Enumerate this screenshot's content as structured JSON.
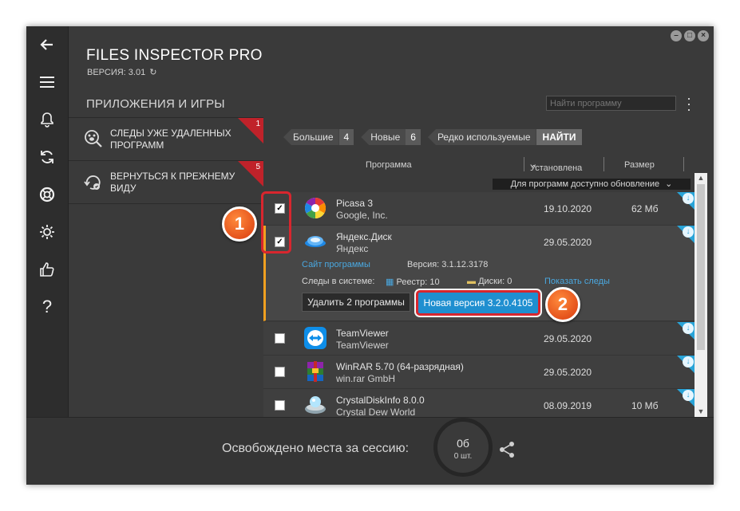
{
  "window": {
    "title": "FILES INSPECTOR PRO",
    "version": "ВЕРСИЯ: 3.01",
    "controls": [
      "minimize-icon",
      "maximize-icon",
      "close-icon"
    ]
  },
  "rail": {
    "icons": [
      "back-arrow-icon",
      "menu-icon",
      "bell-icon",
      "sync-icon",
      "lifebuoy-icon",
      "gear-icon",
      "thumbs-up-icon",
      "help-icon"
    ]
  },
  "section": {
    "title": "ПРИЛОЖЕНИЯ И ИГРЫ"
  },
  "search": {
    "placeholder": "Найти программу"
  },
  "left_panel": {
    "items": [
      {
        "label": "СЛЕДЫ УЖЕ УДАЛЕННЫХ ПРОГРАММ",
        "count": "1",
        "icon": "paw-search-icon"
      },
      {
        "label": "ВЕРНУТЬСЯ К ПРЕЖНЕМУ ВИДУ",
        "count": "5",
        "icon": "restore-icon"
      }
    ]
  },
  "filters": [
    {
      "label": "Большие",
      "count": "4"
    },
    {
      "label": "Новые",
      "count": "6"
    },
    {
      "label": "Редко используемые",
      "button": "НАЙТИ"
    }
  ],
  "table": {
    "headers": {
      "program": "Программа",
      "installed": "Установлена",
      "size": "Размер"
    },
    "update_banner": "Для программ доступно обновление",
    "rows": [
      {
        "name": "Picasa 3",
        "vendor": "Google, Inc.",
        "date": "19.10.2020",
        "size": "62 Мб",
        "checked": true
      },
      {
        "name": "Яндекс.Диск",
        "vendor": "Яндекс",
        "date": "29.05.2020",
        "size": "",
        "checked": true
      },
      {
        "name": "TeamViewer",
        "vendor": "TeamViewer",
        "date": "29.05.2020",
        "size": "",
        "checked": false
      },
      {
        "name": "WinRAR 5.70 (64-разрядная)",
        "vendor": "win.rar GmbH",
        "date": "29.05.2020",
        "size": "",
        "checked": false
      },
      {
        "name": "CrystalDiskInfo 8.0.0",
        "vendor": "Crystal Dew World",
        "date": "08.09.2019",
        "size": "10 Мб",
        "checked": false
      }
    ],
    "expanded": {
      "site_link": "Сайт программы",
      "version": "Версия: 3.1.12.3178",
      "traces_label": "Следы в системе:",
      "registry": "Реестр: 10",
      "disks": "Диски: 0",
      "show_traces": "Показать следы",
      "delete_button": "Удалить 2 программы",
      "new_version_button": "Новая версия 3.2.0.4105"
    }
  },
  "bottom": {
    "freed_label": "Освобождено места за сессию:",
    "freed_value": "0б",
    "freed_count": "0 шт."
  },
  "annotations": {
    "badge1": "1",
    "badge2": "2"
  },
  "colors": {
    "accent_blue": "#1f8fd0",
    "badge_red": "#c0222a",
    "highlight_orange": "#f0a020"
  }
}
